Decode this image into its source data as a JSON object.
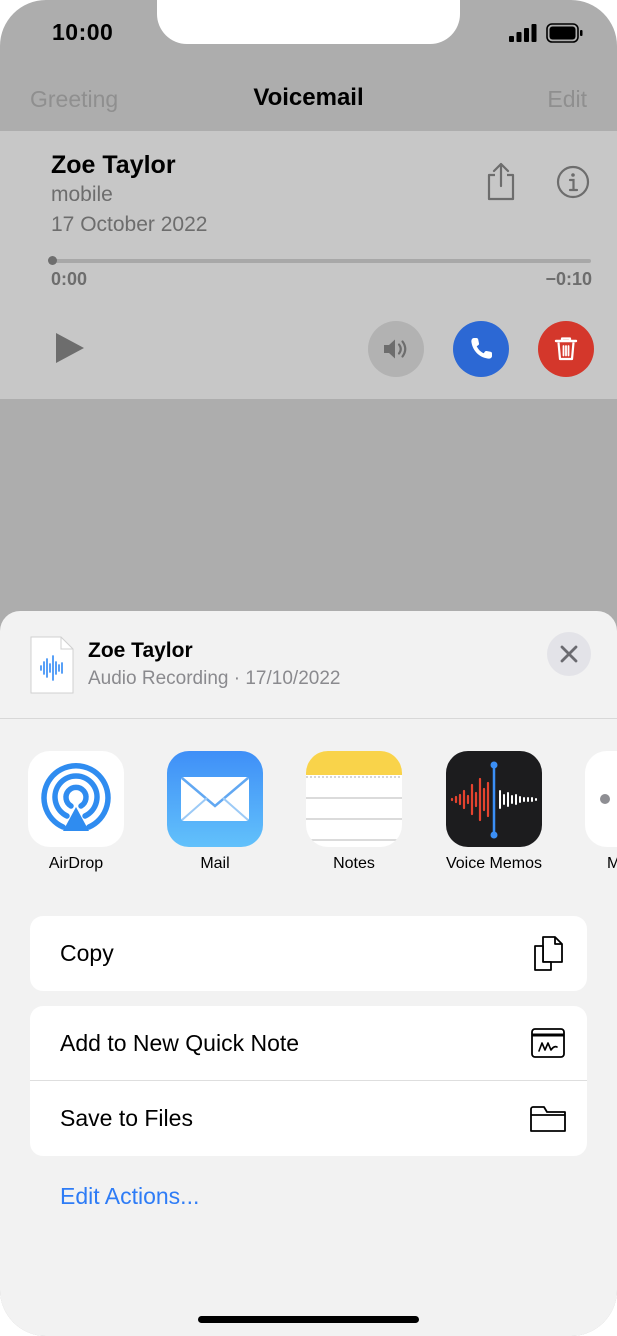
{
  "status": {
    "time": "10:00"
  },
  "nav": {
    "left": "Greeting",
    "title": "Voicemail",
    "right": "Edit"
  },
  "voicemail": {
    "name": "Zoe Taylor",
    "type": "mobile",
    "date": "17 October 2022",
    "elapsed": "0:00",
    "remaining": "−0:10",
    "progress": 0
  },
  "sheet": {
    "title": "Zoe Taylor",
    "subtitle": "Audio Recording · 17/10/2022",
    "apps": [
      {
        "label": "AirDrop",
        "icon": "airdrop-icon"
      },
      {
        "label": "Mail",
        "icon": "mail-icon"
      },
      {
        "label": "Notes",
        "icon": "notes-icon"
      },
      {
        "label": "Voice Memos",
        "icon": "voice-memos-icon"
      },
      {
        "label": "M",
        "icon": "more-app-icon"
      }
    ],
    "actions": [
      {
        "label": "Copy",
        "icon": "copy-icon"
      },
      {
        "label": "Add to New Quick Note",
        "icon": "quick-note-icon"
      },
      {
        "label": "Save to Files",
        "icon": "folder-icon"
      }
    ],
    "edit_actions": "Edit Actions..."
  },
  "colors": {
    "accent": "#2e7cf6",
    "call": "#2c68d4",
    "delete": "#d4372b"
  }
}
